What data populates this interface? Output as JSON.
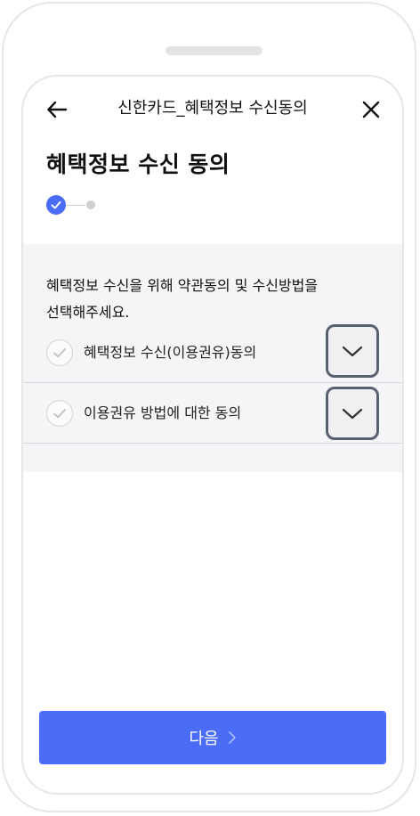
{
  "header": {
    "title": "신한카드_혜택정보 수신동의",
    "back_icon": "back-arrow-icon",
    "close_icon": "close-icon"
  },
  "page": {
    "title": "혜택정보 수신 동의"
  },
  "steps": {
    "current": 1,
    "total": 2,
    "active_color": "#4a6cf7",
    "inactive_color": "#cfcfcf"
  },
  "consent": {
    "intro": "혜택정보 수신을 위해 약관동의 및 수신방법을\n선택해주세요.",
    "items": [
      {
        "label": "혜택정보 수신(이용권유)동의",
        "checked": false
      },
      {
        "label": "이용권유 방법에 대한 동의",
        "checked": false
      }
    ]
  },
  "footer": {
    "next_label": "다음",
    "button_color": "#4a6cf7"
  }
}
